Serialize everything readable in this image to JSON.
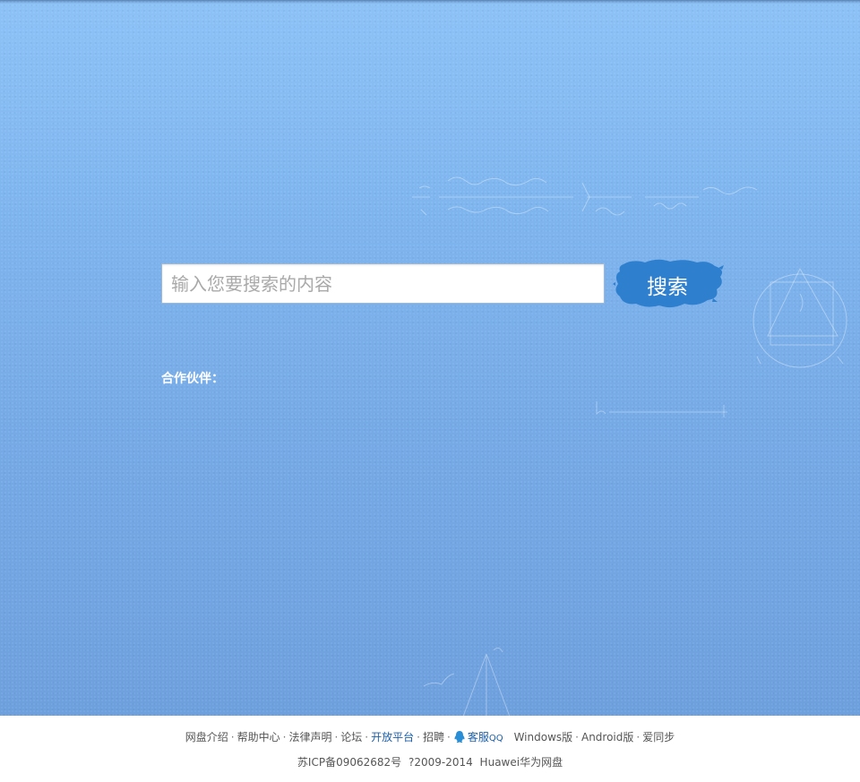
{
  "search": {
    "placeholder": "输入您要搜索的内容",
    "button_label": "搜索"
  },
  "partners": {
    "label": "合作伙伴："
  },
  "footer": {
    "links": [
      {
        "label": "网盘介绍"
      },
      {
        "label": "帮助中心"
      },
      {
        "label": "法律声明"
      },
      {
        "label": "论坛"
      },
      {
        "label": "开放平台"
      },
      {
        "label": "招聘"
      }
    ],
    "qq_label": "客服",
    "qq_suffix": "QQ",
    "client_links": [
      {
        "label": "Windows版"
      },
      {
        "label": "Android版"
      },
      {
        "label": "爱同步"
      }
    ],
    "copyright": "苏ICP备09062682号 ?2009-2014 Huawei华为网盘"
  },
  "colors": {
    "background": "#7fb5ee",
    "button": "#2f7fcf",
    "link_highlight": "#1d5fa8"
  },
  "icons": {
    "qq": "qq-penguin-icon"
  }
}
